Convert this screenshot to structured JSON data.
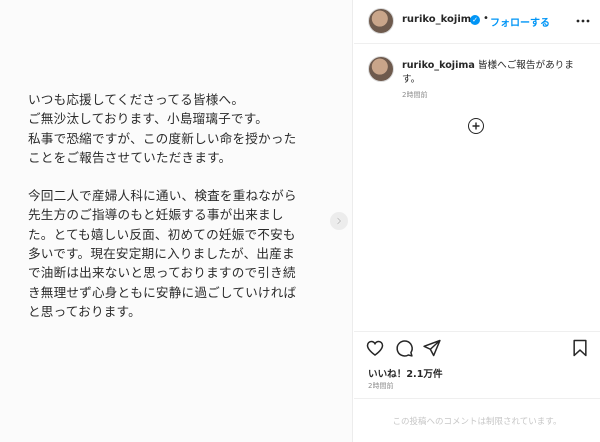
{
  "post": {
    "image_text": {
      "p1": [
        "いつも応援してくださってる皆様へ。",
        "ご無沙汰しております、小島瑠璃子です。",
        "私事で恐縮ですが、この度新しい命を授かった",
        "ことをご報告させていただきます。"
      ],
      "p2": [
        "今回二人で産婦人科に通い、検査を重ねながら",
        "先生方のご指導のもと妊娠する事が出来まし",
        "た。とても嬉しい反面、初めての妊娠で不安も",
        "多いです。現在安定期に入りましたが、出産ま",
        "で油断は出来ないと思っておりますので引き続",
        "き無理せず心身ともに安静に過ごしていければ",
        "と思っております。"
      ]
    },
    "next_icon": "chevron-right-icon"
  },
  "header": {
    "username": "ruriko_kojima",
    "verified_icon": "verified-badge-icon",
    "separator": "•",
    "follow_label": "フォローする",
    "more_icon": "more-icon"
  },
  "caption": {
    "username": "ruriko_kojima",
    "text": "皆様へご報告があります。",
    "time": "2時間前"
  },
  "add_icon": "plus-circle-icon",
  "actions": {
    "icons": [
      "heart-icon",
      "comment-icon",
      "share-icon",
      "bookmark-icon"
    ]
  },
  "likes_label": "いいね！2.1万件",
  "post_time": "2時間前",
  "comments_notice": "この投稿へのコメントは制限されています。",
  "colors": {
    "accent": "#0095f6",
    "text": "#262626",
    "muted": "#8e8e8e",
    "border": "#efefef"
  }
}
